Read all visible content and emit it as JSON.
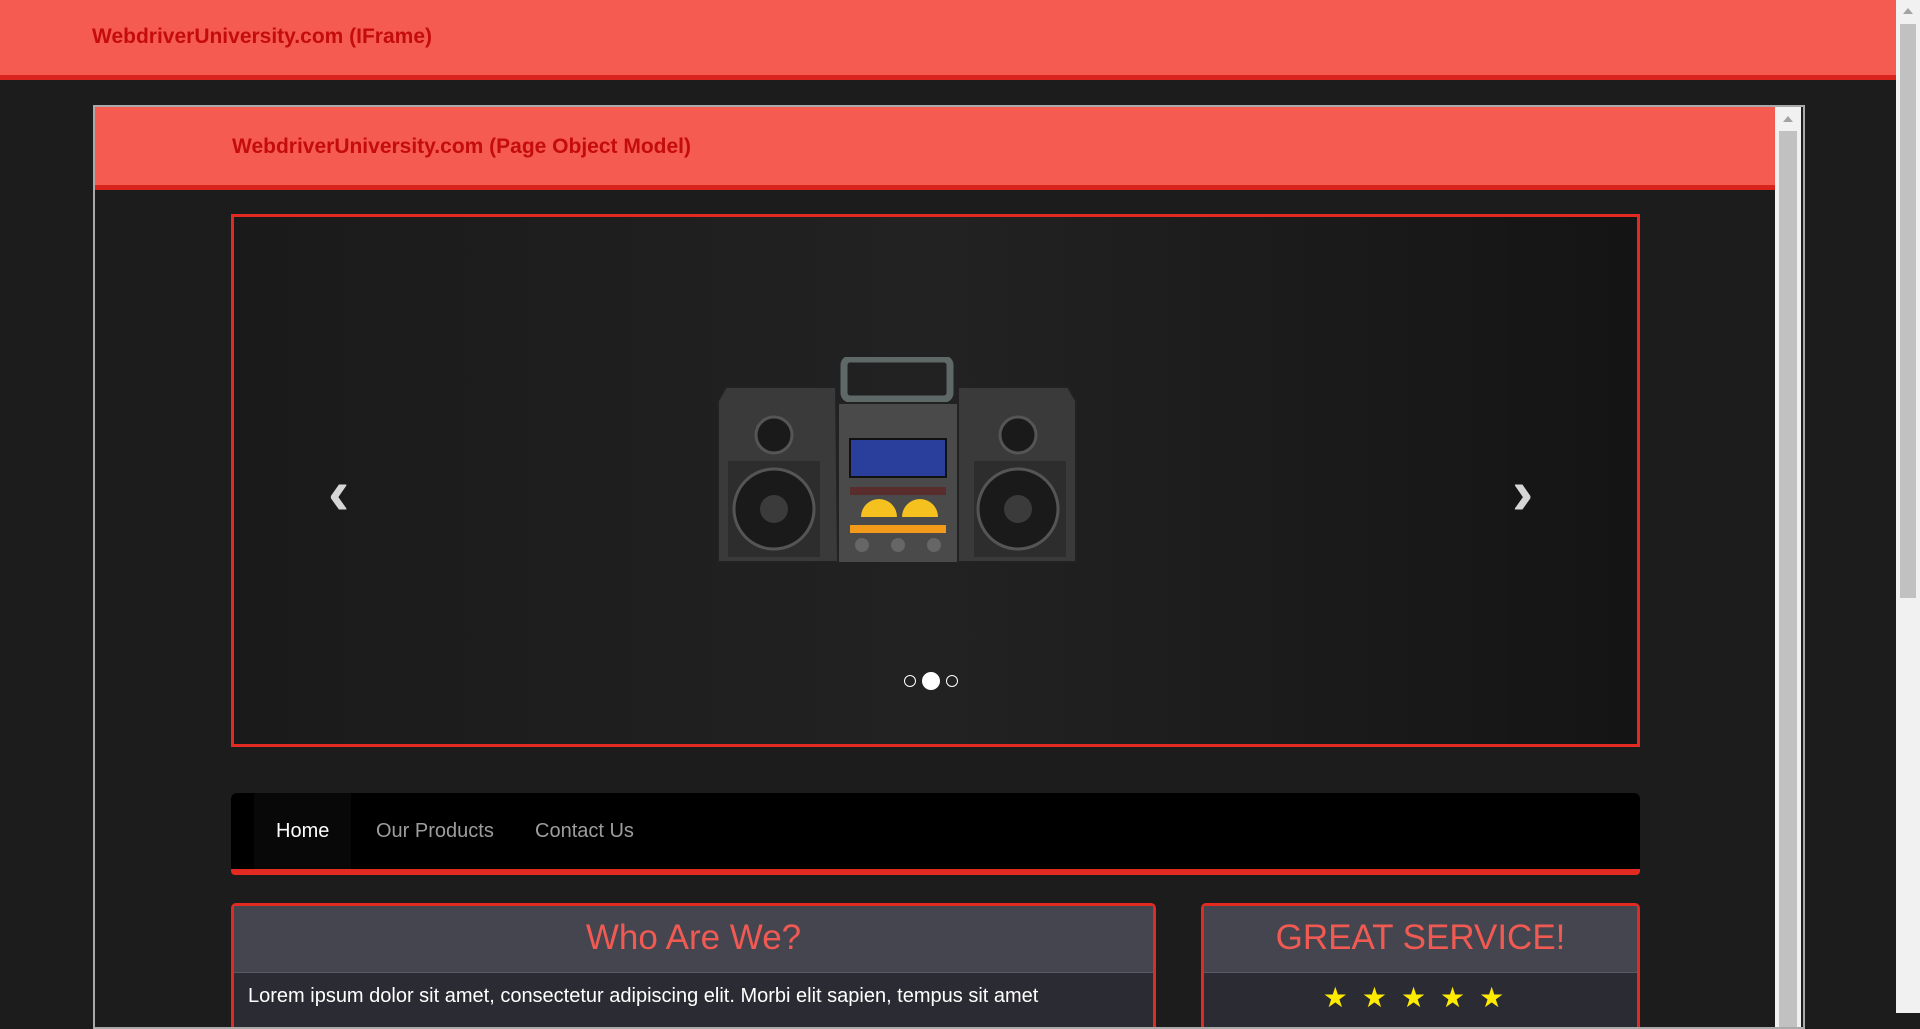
{
  "outer": {
    "title": "WebdriverUniversity.com (IFrame)"
  },
  "inner": {
    "title": "WebdriverUniversity.com (Page Object Model)"
  },
  "carousel": {
    "prev_icon": "chevron-left-icon",
    "next_icon": "chevron-right-icon",
    "prev_glyph": "‹",
    "next_glyph": "›",
    "slide_count": 3,
    "active_slide": 2
  },
  "nav": {
    "items": [
      {
        "label": "Home",
        "active": true
      },
      {
        "label": "Our Products",
        "active": false
      },
      {
        "label": "Contact Us",
        "active": false
      }
    ]
  },
  "panels": {
    "who": {
      "title": "Who Are We?",
      "text": "Lorem ipsum dolor sit amet, consectetur adipiscing elit. Morbi elit sapien, tempus sit amet"
    },
    "service": {
      "title": "GREAT SERVICE!",
      "stars": "★★★★★",
      "rating": 5
    }
  },
  "colors": {
    "header": "#f65b52",
    "accent": "#e22a22",
    "title_text": "#c40d0a",
    "panel_title": "#f05a52",
    "star": "#ffeb00"
  }
}
